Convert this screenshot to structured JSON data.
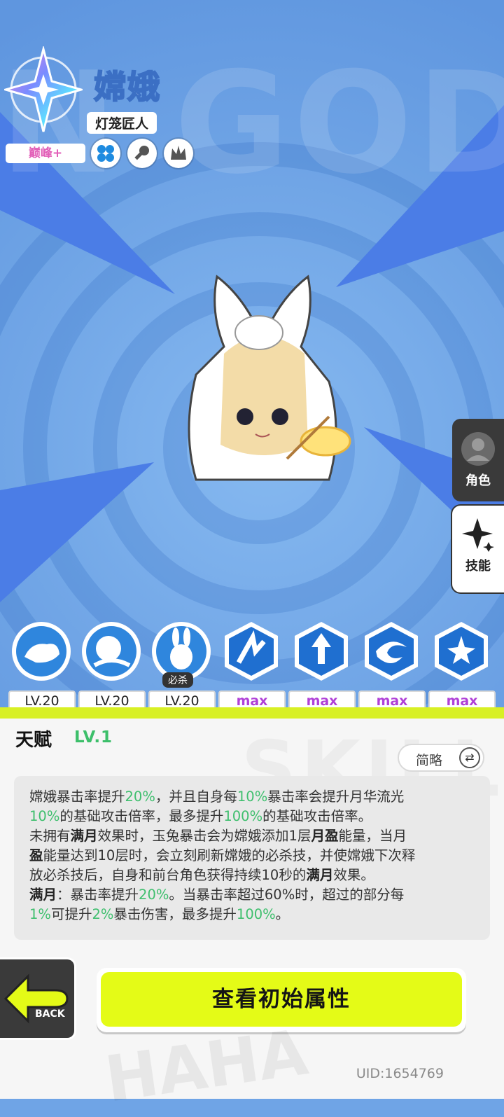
{
  "background_text": "N GOD",
  "character": {
    "name": "嫦娥",
    "title": "灯笼匠人",
    "rank": "巅峰+",
    "element_icons": [
      "clover-icon",
      "key-icon",
      "flame-crown-icon"
    ]
  },
  "side_tabs": [
    {
      "label": "角色",
      "icon": "person-icon"
    },
    {
      "label": "技能",
      "icon": "sparkle-icon"
    }
  ],
  "skills": [
    {
      "icon": "cloud-rabbit-icon",
      "level": "LV.20"
    },
    {
      "icon": "moon-cloud-icon",
      "level": "LV.20"
    },
    {
      "icon": "jade-rabbit-icon",
      "level": "LV.20",
      "badge": "必杀"
    },
    {
      "icon": "slash-hex-icon",
      "level": "max"
    },
    {
      "icon": "arrow-up-hex-icon",
      "level": "max"
    },
    {
      "icon": "vortex-hex-icon",
      "level": "max"
    },
    {
      "icon": "star-wave-hex-icon",
      "level": "max"
    }
  ],
  "talent": {
    "heading": "天赋",
    "level": "LV.1",
    "toggle_label": "简略",
    "segments": [
      {
        "t": "嫦娥暴击率提升",
        "s": "n"
      },
      {
        "t": "20%",
        "s": "g"
      },
      {
        "t": "，并且自身每",
        "s": "n"
      },
      {
        "t": "10%",
        "s": "g"
      },
      {
        "t": "暴击率会提升月华流光",
        "s": "n"
      },
      {
        "t": "\n",
        "s": "br"
      },
      {
        "t": "10%",
        "s": "g"
      },
      {
        "t": "的基础攻击倍率，最多提升",
        "s": "n"
      },
      {
        "t": "100%",
        "s": "g"
      },
      {
        "t": "的基础攻击倍率。",
        "s": "n"
      },
      {
        "t": "\n",
        "s": "br"
      },
      {
        "t": "未拥有",
        "s": "n"
      },
      {
        "t": "满月",
        "s": "b"
      },
      {
        "t": "效果时，玉兔暴击会为嫦娥添加1层",
        "s": "n"
      },
      {
        "t": "月盈",
        "s": "b"
      },
      {
        "t": "能量，当月",
        "s": "n"
      },
      {
        "t": "\n",
        "s": "br"
      },
      {
        "t": "盈",
        "s": "b"
      },
      {
        "t": "能量达到10层时，会立刻刷新嫦娥的必杀技，并使嫦娥下次释",
        "s": "n"
      },
      {
        "t": "\n",
        "s": "br"
      },
      {
        "t": "放必杀技后，自身和前台角色获得持续10秒的",
        "s": "n"
      },
      {
        "t": "满月",
        "s": "b"
      },
      {
        "t": "效果。",
        "s": "n"
      },
      {
        "t": "\n",
        "s": "br"
      },
      {
        "t": "满月",
        "s": "b"
      },
      {
        "t": "：暴击率提升",
        "s": "n"
      },
      {
        "t": "20%",
        "s": "g"
      },
      {
        "t": "。当暴击率超过60%时，超过的部分每",
        "s": "n"
      },
      {
        "t": "\n",
        "s": "br"
      },
      {
        "t": "1%",
        "s": "g"
      },
      {
        "t": "可提升",
        "s": "n"
      },
      {
        "t": "2%",
        "s": "g"
      },
      {
        "t": "暴击伤害，最多提升",
        "s": "n"
      },
      {
        "t": "100%",
        "s": "g"
      },
      {
        "t": "。",
        "s": "n"
      }
    ]
  },
  "back_label": "BACK",
  "view_stats_label": "查看初始属性",
  "uid": "UID:1654769",
  "colors": {
    "accent_lime": "#e4fb17",
    "talent_green": "#3fbf6e",
    "max_purple": "#b040d8"
  }
}
